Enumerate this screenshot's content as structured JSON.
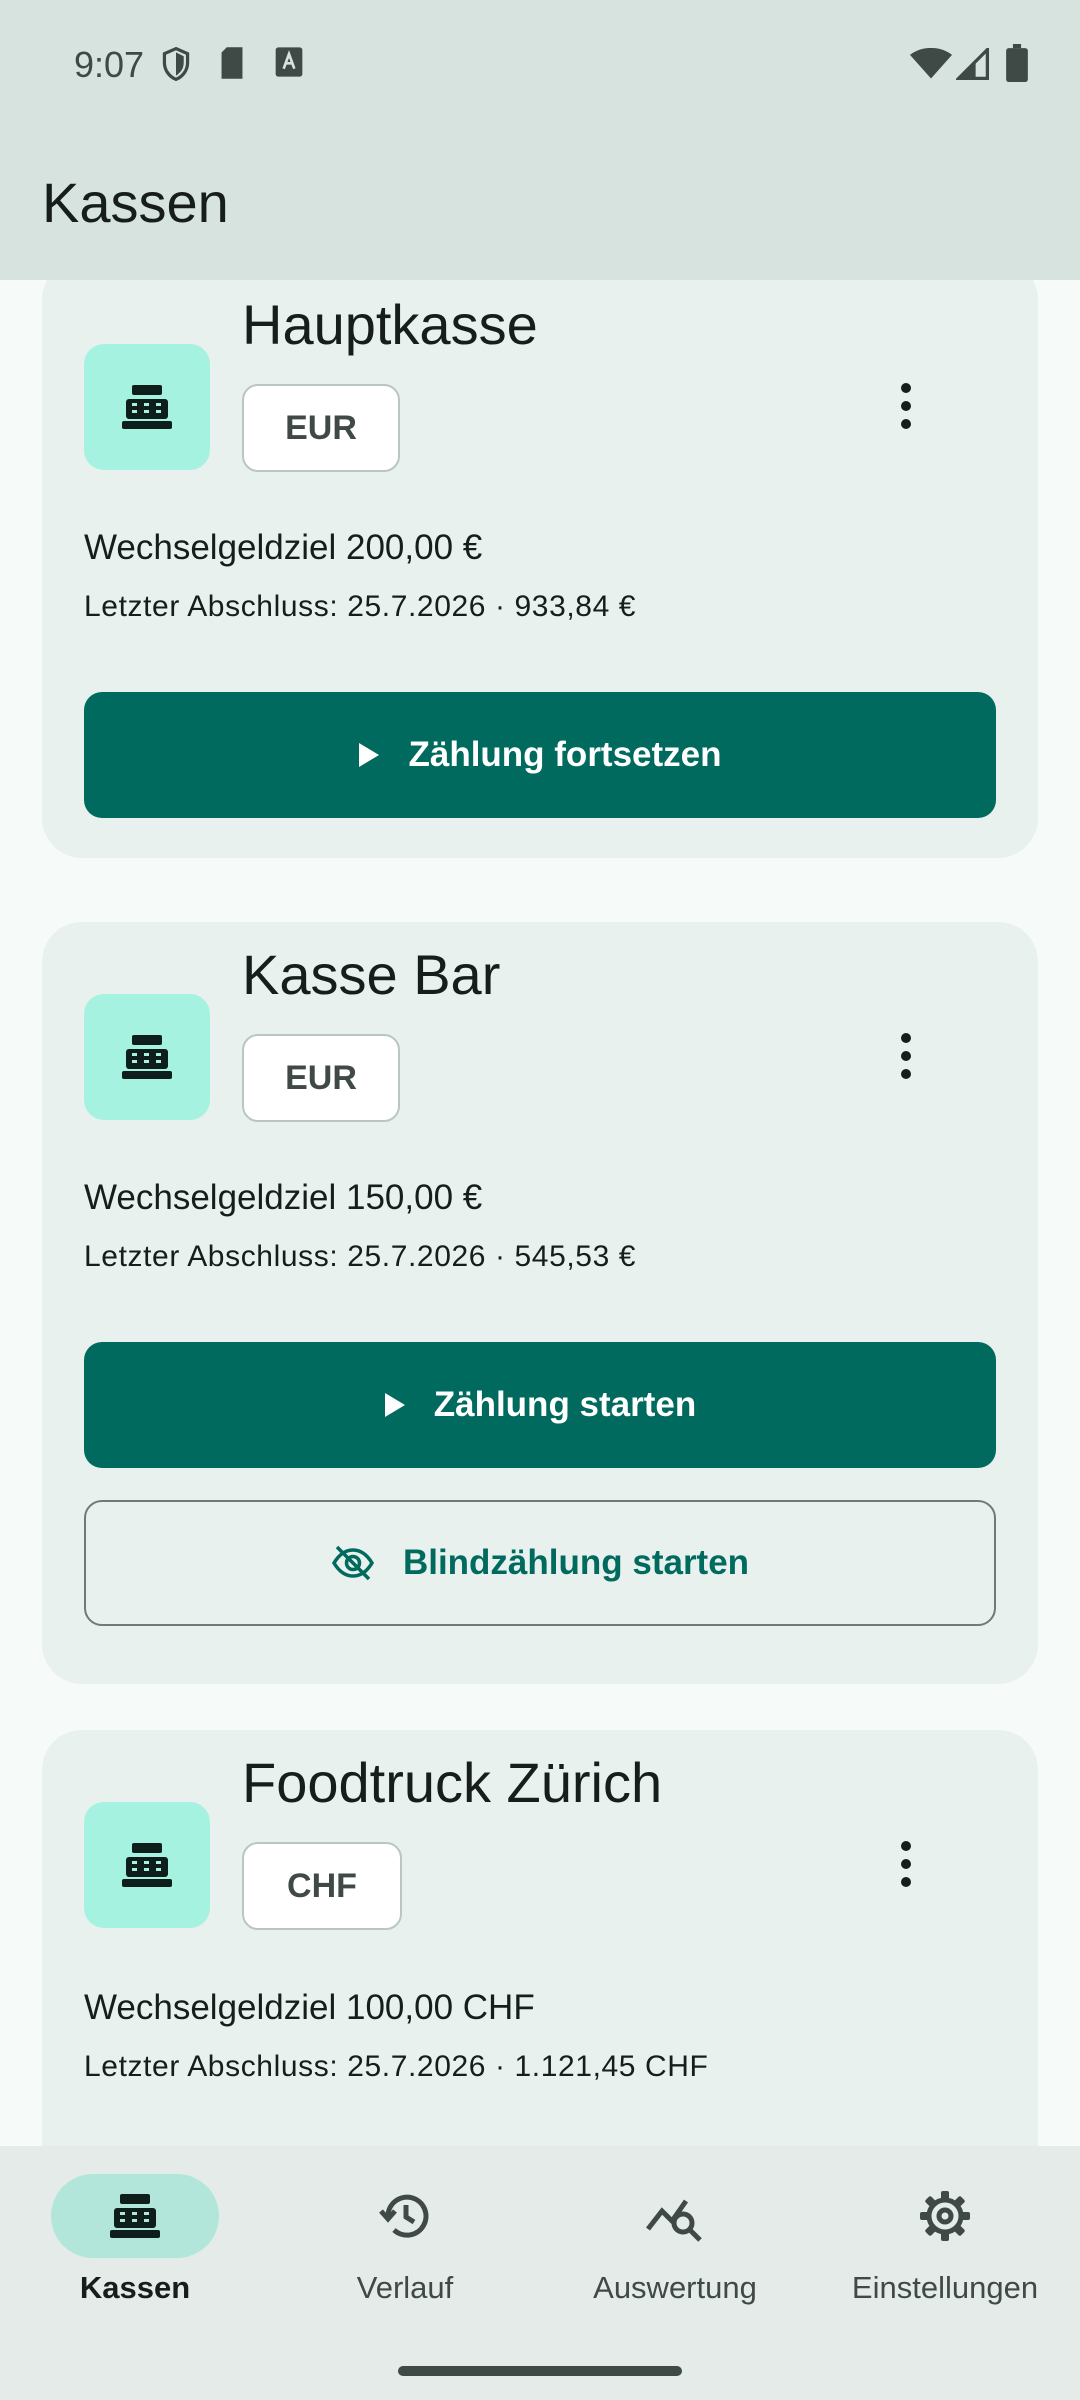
{
  "status": {
    "time": "9:07"
  },
  "appbar": {
    "title": "Kassen"
  },
  "cards": [
    {
      "name": "Hauptkasse",
      "currency": "EUR",
      "target": "Wechselgeldziel 200,00 €",
      "last": "Letzter Abschluss: 25.7.2026 · 933,84 €",
      "primary_label": "Zählung fortsetzen"
    },
    {
      "name": "Kasse Bar",
      "currency": "EUR",
      "target": "Wechselgeldziel 150,00 €",
      "last": "Letzter Abschluss: 25.7.2026 · 545,53 €",
      "primary_label": "Zählung starten",
      "secondary_label": "Blindzählung starten"
    },
    {
      "name": "Foodtruck Zürich",
      "currency": "CHF",
      "target": "Wechselgeldziel 100,00 CHF",
      "last": "Letzter Abschluss: 25.7.2026 · 1.121,45 CHF"
    }
  ],
  "nav": [
    {
      "label": "Kassen",
      "icon": "cash-register-icon",
      "active": true
    },
    {
      "label": "Verlauf",
      "icon": "history-icon"
    },
    {
      "label": "Auswertung",
      "icon": "analytics-icon"
    },
    {
      "label": "Einstellungen",
      "icon": "gear-icon"
    }
  ],
  "colors": {
    "primary": "#006a5e",
    "icon_bg": "#a4f2df",
    "card_bg": "#e8f1ee",
    "bar_bg": "#d6e3df"
  }
}
